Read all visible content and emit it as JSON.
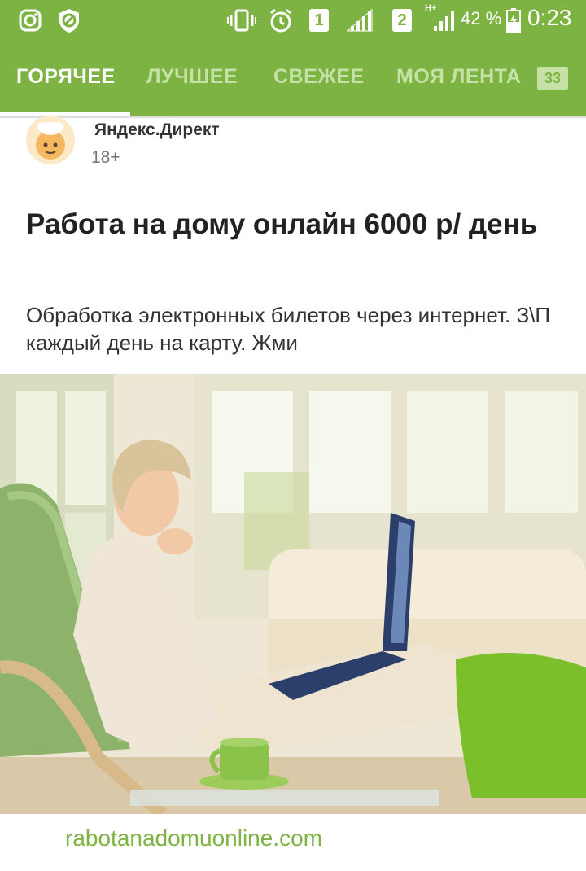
{
  "status_bar": {
    "sim1": "1",
    "sim2": "2",
    "network": "H+",
    "battery": "42 %",
    "time": "0:23"
  },
  "tabs": [
    {
      "label": "ГОРЯЧЕЕ",
      "active": true
    },
    {
      "label": "ЛУЧШЕЕ",
      "active": false
    },
    {
      "label": "СВЕЖЕЕ",
      "active": false
    },
    {
      "label": "МОЯ ЛЕНТА",
      "active": false
    }
  ],
  "feed_badge": "33",
  "ad": {
    "advertiser": "Яндекс.Директ",
    "age_rating": "18+",
    "title": "Работа на дому онлайн 6000 р/ день",
    "description": "Обработка электронных билетов через интернет. З\\П каждый день на карту. Жми",
    "domain": "rabotanadomuonline.com"
  },
  "colors": {
    "accent": "#7cb342",
    "tab_inactive": "#c5e1a5",
    "domain_link": "#7cb342"
  }
}
